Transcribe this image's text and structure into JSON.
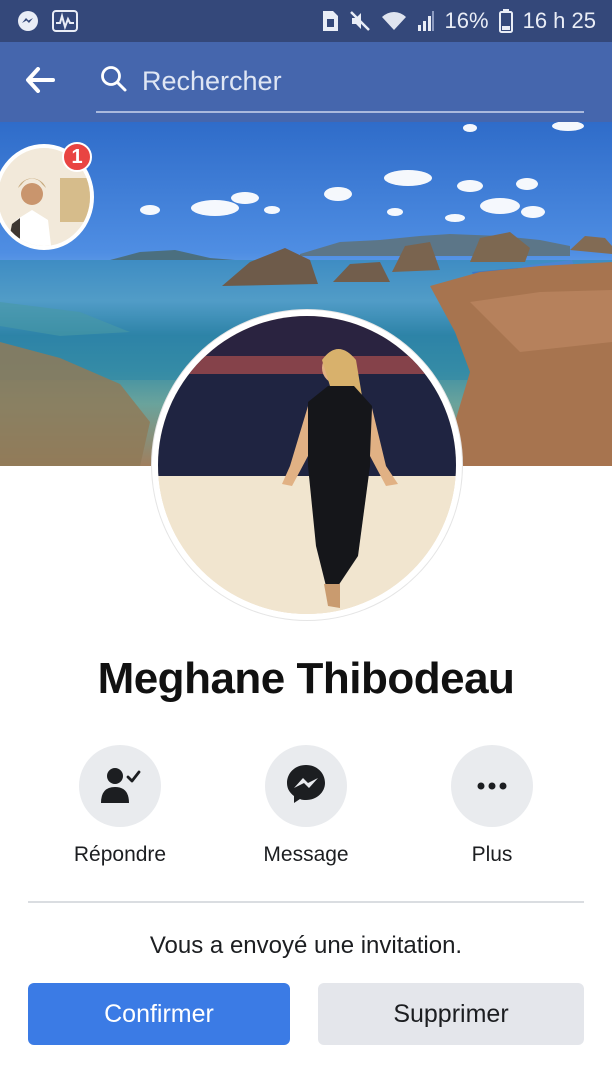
{
  "status_bar": {
    "battery": "16%",
    "time": "16 h 25",
    "left_icons": [
      "messenger-icon",
      "activity-icon"
    ],
    "right_icons": [
      "sim-icon",
      "mute-icon",
      "wifi-icon",
      "signal-icon",
      "battery-icon"
    ]
  },
  "app_bar": {
    "back_icon": "arrow-left-icon",
    "search_placeholder": "Rechercher"
  },
  "notification_badge": "1",
  "profile": {
    "name": "Meghane Thibodeau"
  },
  "actions": [
    {
      "label": "Répondre",
      "icon": "person-check-icon"
    },
    {
      "label": "Message",
      "icon": "messenger-icon"
    },
    {
      "label": "Plus",
      "icon": "more-icon"
    }
  ],
  "invitation": {
    "text": "Vous a envoyé une invitation.",
    "confirm_label": "Confirmer",
    "delete_label": "Supprimer"
  },
  "colors": {
    "status_bar": "#34487a",
    "app_bar": "#4566ad",
    "primary_button": "#3b7be5",
    "secondary_button": "#e4e6eb",
    "badge": "#e94442"
  }
}
